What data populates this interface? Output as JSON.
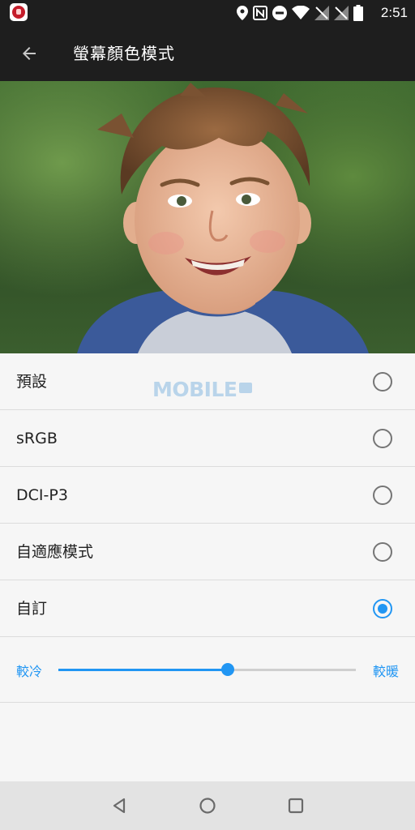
{
  "status_bar": {
    "time": "2:51",
    "icons": [
      "location-icon",
      "nfc-icon",
      "do-not-disturb-icon",
      "wifi-icon",
      "no-signal-icon",
      "no-signal-icon",
      "battery-icon"
    ]
  },
  "header": {
    "title": "螢幕顏色模式",
    "back_icon": "arrow-back-icon"
  },
  "preview": {
    "carousel_pages": 3,
    "active_page": 1
  },
  "watermark": "MOBILE",
  "options": [
    {
      "label": "預設",
      "selected": false
    },
    {
      "label": "sRGB",
      "selected": false
    },
    {
      "label": "DCI-P3",
      "selected": false
    },
    {
      "label": "自適應模式",
      "selected": false
    },
    {
      "label": "自訂",
      "selected": true
    }
  ],
  "temperature_slider": {
    "left_label": "較冷",
    "right_label": "較暖",
    "value_fraction": 0.57
  },
  "navigation": {
    "buttons": [
      "back-triangle-icon",
      "home-circle-icon",
      "recents-square-icon"
    ]
  },
  "colors": {
    "accent": "#2196f3",
    "bar": "#1e1e1e"
  }
}
